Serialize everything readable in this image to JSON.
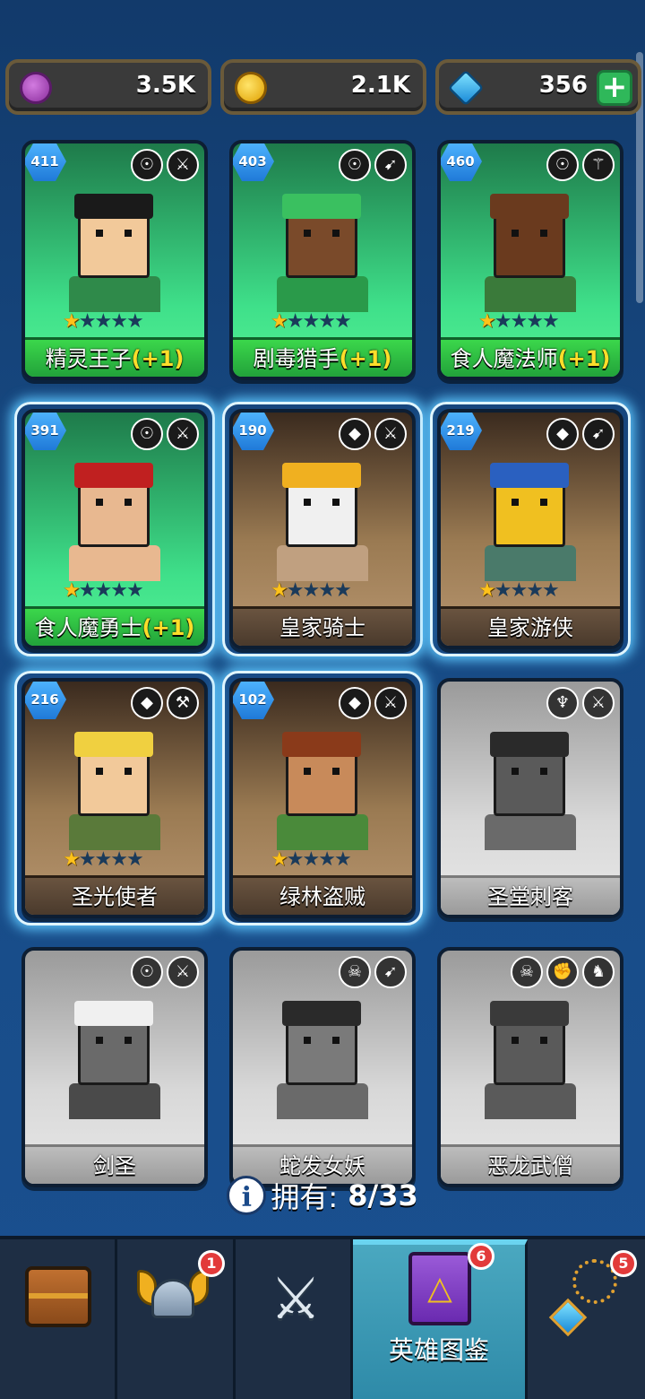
{
  "resources": {
    "purple": {
      "value": "3.5K",
      "icon": "purple-coin-icon"
    },
    "gold": {
      "value": "2.1K",
      "icon": "gold-coin-icon"
    },
    "gem": {
      "value": "356",
      "icon": "gem-icon",
      "plus": "+"
    }
  },
  "heroes": [
    {
      "name": "精灵王子",
      "bonus": "(+1)",
      "level": "411",
      "stars": 1,
      "state": "owned-green",
      "glow": false,
      "tags": [
        "elf-faction-icon",
        "dagger-class-icon"
      ],
      "glyphs": [
        "☉",
        "⚔"
      ],
      "skin": "#f2c99a",
      "hair": "#1a1a1a",
      "body": "#2f8a4a"
    },
    {
      "name": "剧毒猎手",
      "bonus": "(+1)",
      "level": "403",
      "stars": 1,
      "state": "owned-green",
      "glow": false,
      "tags": [
        "orc-faction-icon",
        "bow-class-icon"
      ],
      "glyphs": [
        "☉",
        "➹"
      ],
      "skin": "#7a4a2a",
      "hair": "#3ac060",
      "body": "#2a9a4a"
    },
    {
      "name": "食人魔法师",
      "bonus": "(+1)",
      "level": "460",
      "stars": 1,
      "state": "owned-green",
      "glow": false,
      "tags": [
        "orc-faction-icon",
        "staff-class-icon"
      ],
      "glyphs": [
        "☉",
        "⚚"
      ],
      "skin": "#6a3a1e",
      "hair": "#6a3a1e",
      "body": "#3a7a3a"
    },
    {
      "name": "食人魔勇士",
      "bonus": "(+1)",
      "level": "391",
      "stars": 1,
      "state": "owned-green",
      "glow": true,
      "tags": [
        "orc-faction-icon",
        "sword-class-icon"
      ],
      "glyphs": [
        "☉",
        "⚔"
      ],
      "skin": "#e8b890",
      "hair": "#c02020",
      "body": "#e8b890"
    },
    {
      "name": "皇家骑士",
      "bonus": "",
      "level": "190",
      "stars": 1,
      "state": "owned-brown",
      "glow": true,
      "tags": [
        "helmet-faction-icon",
        "sword-class-icon"
      ],
      "glyphs": [
        "◆",
        "⚔"
      ],
      "skin": "#f0f0f0",
      "hair": "#f0b020",
      "body": "#c0a080"
    },
    {
      "name": "皇家游侠",
      "bonus": "",
      "level": "219",
      "stars": 1,
      "state": "owned-brown",
      "glow": true,
      "tags": [
        "helmet-faction-icon",
        "bow-class-icon"
      ],
      "glyphs": [
        "◆",
        "➹"
      ],
      "skin": "#f0c020",
      "hair": "#2a60c0",
      "body": "#4a7a6a"
    },
    {
      "name": "圣光使者",
      "bonus": "",
      "level": "216",
      "stars": 1,
      "state": "owned-brown",
      "glow": true,
      "tags": [
        "helmet-faction-icon",
        "hammer-class-icon"
      ],
      "glyphs": [
        "◆",
        "⚒"
      ],
      "skin": "#f2c99a",
      "hair": "#f0d040",
      "body": "#5a7a3a"
    },
    {
      "name": "绿林盗贼",
      "bonus": "",
      "level": "102",
      "stars": 1,
      "state": "owned-brown",
      "glow": true,
      "tags": [
        "helmet-faction-icon",
        "dagger-class-icon"
      ],
      "glyphs": [
        "◆",
        "⚔"
      ],
      "skin": "#c88a5a",
      "hair": "#8a3a1a",
      "body": "#4a8a3a"
    },
    {
      "name": "圣堂刺客",
      "bonus": "",
      "level": "",
      "stars": 0,
      "state": "locked",
      "glow": false,
      "tags": [
        "angel-faction-icon",
        "dagger-class-icon"
      ],
      "glyphs": [
        "♆",
        "⚔"
      ],
      "skin": "#5a5a5a",
      "hair": "#2a2a2a",
      "body": "#6a6a6a"
    },
    {
      "name": "剑圣",
      "bonus": "",
      "level": "",
      "stars": 0,
      "state": "locked",
      "glow": false,
      "tags": [
        "orc-faction-icon",
        "sword-class-icon"
      ],
      "glyphs": [
        "☉",
        "⚔"
      ],
      "skin": "#6a6a6a",
      "hair": "#f0f0f0",
      "body": "#4a4a4a"
    },
    {
      "name": "蛇发女妖",
      "bonus": "",
      "level": "",
      "stars": 0,
      "state": "locked",
      "glow": false,
      "tags": [
        "demon-faction-icon",
        "bow-class-icon"
      ],
      "glyphs": [
        "☠",
        "➹"
      ],
      "skin": "#7a7a7a",
      "hair": "#2a2a2a",
      "body": "#6a6a6a"
    },
    {
      "name": "恶龙武僧",
      "bonus": "",
      "level": "",
      "stars": 0,
      "state": "locked",
      "glow": false,
      "tags": [
        "demon-faction-icon",
        "fist-class-icon",
        "dragon-class-icon"
      ],
      "glyphs": [
        "☠",
        "✊",
        "♞"
      ],
      "skin": "#5a5a5a",
      "hair": "#3a3a3a",
      "body": "#5a5a5a"
    }
  ],
  "owned": {
    "label": "拥有:",
    "count": "8/33",
    "icon": "info-icon"
  },
  "nav": [
    {
      "id": "shop",
      "icon": "treasure-chest-icon",
      "label": "",
      "badge": "",
      "active": false
    },
    {
      "id": "heroes",
      "icon": "viking-helmet-icon",
      "label": "",
      "badge": "1",
      "active": false
    },
    {
      "id": "battle",
      "icon": "crossed-swords-icon",
      "label": "",
      "badge": "",
      "active": false
    },
    {
      "id": "codex",
      "icon": "spell-book-icon",
      "label": "英雄图鉴",
      "badge": "6",
      "active": true
    },
    {
      "id": "items",
      "icon": "amulet-icon",
      "label": "",
      "badge": "5",
      "active": false
    }
  ],
  "colors": {
    "accent": "#6fd0ff",
    "star": "#ffc21a",
    "bonus": "#ffde2a",
    "badge": "#e23a3a"
  }
}
